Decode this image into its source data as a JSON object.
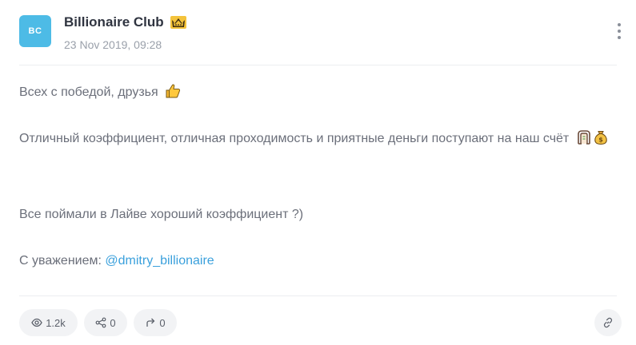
{
  "post": {
    "avatar_initials": "BC",
    "avatar_color": "#4dbbe6",
    "channel_name": "Billionaire Club",
    "badge_icon": "crown-icon",
    "date": "23 Nov 2019, 09:28",
    "menu_icon": "more-vertical-icon"
  },
  "content": {
    "line1": "Всех с победой, друзья",
    "line1_emoji": "thumbs-up-icon",
    "line2": "Отличный коэффициент, отличная проходимость и приятные деньги поступают на наш счёт",
    "line2_emojis": [
      "dollar-banknote-icon",
      "money-bag-icon"
    ],
    "line3": "Все поймали в Лайве хороший коэффициент ?)",
    "line4_prefix": "С уважением:",
    "mention": "@dmitry_billionaire",
    "mention_color": "#3aa0dc"
  },
  "footer": {
    "views": "1.2k",
    "views_icon": "eye-icon",
    "shares": "0",
    "shares_icon": "share-icon",
    "forwards": "0",
    "forwards_icon": "forward-icon",
    "link_icon": "link-icon"
  }
}
